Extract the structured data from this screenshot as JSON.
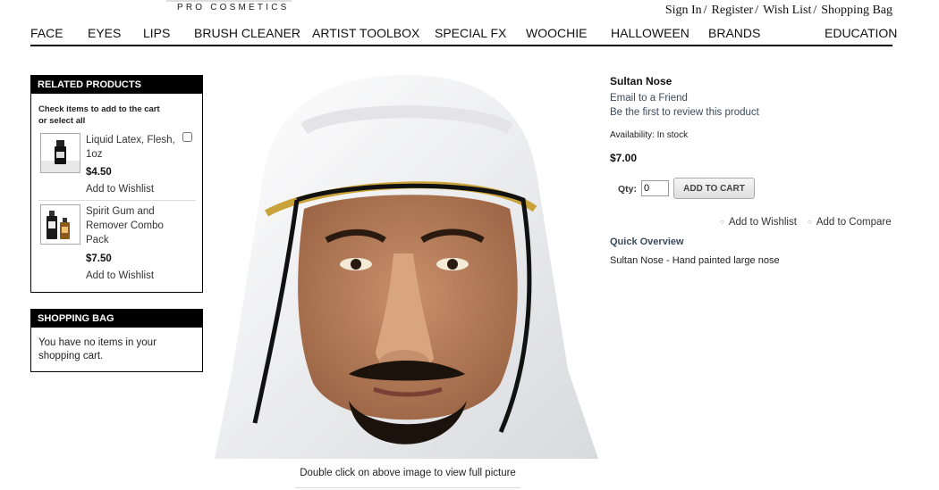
{
  "brand": {
    "logo_text": "PRO COSMETICS"
  },
  "top_links": {
    "sign_in": "Sign In",
    "register": "Register",
    "wish_list": "Wish List",
    "shopping_bag": "Shopping Bag",
    "separator": "/"
  },
  "nav": {
    "items": [
      "FACE",
      "EYES",
      "LIPS",
      "BRUSH CLEANER",
      "ARTIST TOOLBOX",
      "SPECIAL FX",
      "WOOCHIE",
      "HALLOWEEN",
      "BRANDS",
      "EDUCATION"
    ]
  },
  "related_products": {
    "heading": "RELATED PRODUCTS",
    "intro": "Check items to add to the cart",
    "intro_or": "or",
    "select_all": "select all",
    "items": [
      {
        "name": "Liquid Latex, Flesh, 1oz",
        "price": "$4.50",
        "wishlist": "Add to Wishlist"
      },
      {
        "name": "Spirit Gum and Remover Combo Pack",
        "price": "$7.50",
        "wishlist": "Add to Wishlist"
      }
    ]
  },
  "shopping_bag": {
    "heading": "SHOPPING BAG",
    "empty_text": "You have no items in your shopping cart."
  },
  "product": {
    "name": "Sultan Nose",
    "email_friend": "Email to a Friend",
    "review": "Be the first to review this product",
    "availability": "Availability: In stock",
    "price": "$7.00",
    "qty_label": "Qty:",
    "qty_value": "0",
    "add_to_cart": "ADD TO CART",
    "add_to_wishlist": "Add to Wishlist",
    "add_to_compare": "Add to Compare",
    "overview_title": "Quick Overview",
    "overview_text": "Sultan Nose - Hand painted large nose",
    "image_caption": "Double click on above image to view full picture"
  },
  "colors": {
    "nav_border": "#000000",
    "box_header_bg": "#000000",
    "link_blue": "#3a4a5c",
    "button_bg": "#e6e6e6"
  },
  "icons": {
    "bullet": "bullet-icon"
  }
}
